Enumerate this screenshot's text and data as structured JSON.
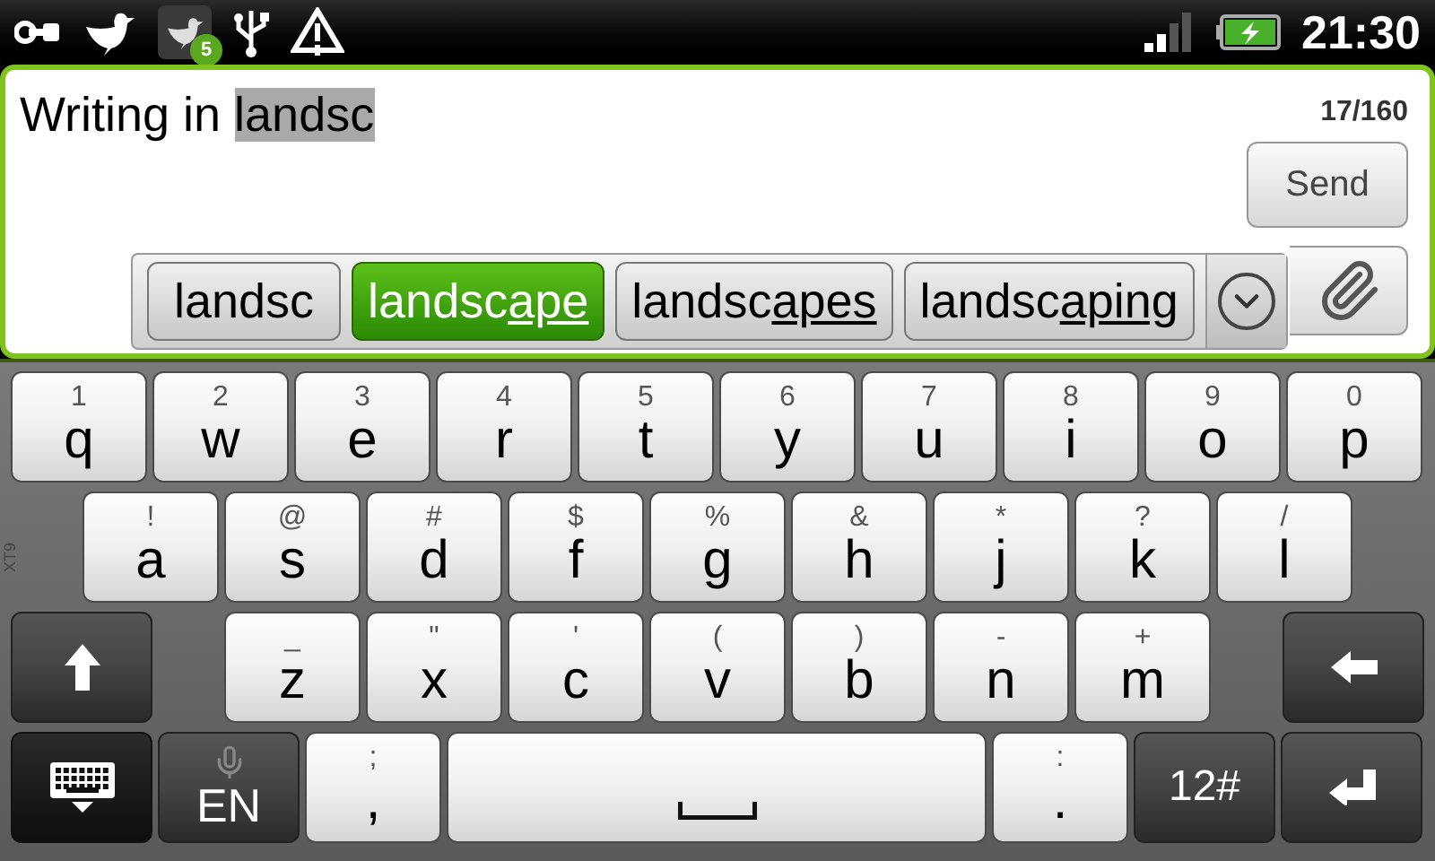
{
  "status_bar": {
    "notification_badge": "5",
    "time": "21:30"
  },
  "compose": {
    "text": "Writing in ",
    "composing": "landsc",
    "counter": "17/160",
    "send_label": "Send"
  },
  "suggestions": [
    {
      "typed": "landsc",
      "selected": false
    },
    {
      "typed": "landsc",
      "completion": "ape",
      "selected": true
    },
    {
      "typed": "landsc",
      "completion": "apes",
      "selected": false
    },
    {
      "typed": "landsc",
      "completion": "aping",
      "selected": false
    }
  ],
  "keyboard": {
    "side_label": "XT9",
    "rows": [
      [
        {
          "kind": "letter",
          "main": "q",
          "alt": "1"
        },
        {
          "kind": "letter",
          "main": "w",
          "alt": "2"
        },
        {
          "kind": "letter",
          "main": "e",
          "alt": "3"
        },
        {
          "kind": "letter",
          "main": "r",
          "alt": "4"
        },
        {
          "kind": "letter",
          "main": "t",
          "alt": "5"
        },
        {
          "kind": "letter",
          "main": "y",
          "alt": "6"
        },
        {
          "kind": "letter",
          "main": "u",
          "alt": "7"
        },
        {
          "kind": "letter",
          "main": "i",
          "alt": "8"
        },
        {
          "kind": "letter",
          "main": "o",
          "alt": "9"
        },
        {
          "kind": "letter",
          "main": "p",
          "alt": "0"
        }
      ],
      [
        {
          "kind": "letter",
          "main": "a",
          "alt": "!"
        },
        {
          "kind": "letter",
          "main": "s",
          "alt": "@"
        },
        {
          "kind": "letter",
          "main": "d",
          "alt": "#"
        },
        {
          "kind": "letter",
          "main": "f",
          "alt": "$"
        },
        {
          "kind": "letter",
          "main": "g",
          "alt": "%"
        },
        {
          "kind": "letter",
          "main": "h",
          "alt": "&"
        },
        {
          "kind": "letter",
          "main": "j",
          "alt": "*"
        },
        {
          "kind": "letter",
          "main": "k",
          "alt": "?"
        },
        {
          "kind": "letter",
          "main": "l",
          "alt": "/"
        }
      ],
      [
        {
          "kind": "shift"
        },
        {
          "kind": "letter",
          "main": "z",
          "alt": "_"
        },
        {
          "kind": "letter",
          "main": "x",
          "alt": "\""
        },
        {
          "kind": "letter",
          "main": "c",
          "alt": "'"
        },
        {
          "kind": "letter",
          "main": "v",
          "alt": "("
        },
        {
          "kind": "letter",
          "main": "b",
          "alt": ")"
        },
        {
          "kind": "letter",
          "main": "n",
          "alt": "-"
        },
        {
          "kind": "letter",
          "main": "m",
          "alt": "+"
        },
        {
          "kind": "backspace"
        }
      ],
      [
        {
          "kind": "hide"
        },
        {
          "kind": "language",
          "main": "EN"
        },
        {
          "kind": "letter",
          "main": ",",
          "alt": ";"
        },
        {
          "kind": "space"
        },
        {
          "kind": "letter",
          "main": ".",
          "alt": ":"
        },
        {
          "kind": "symbols",
          "main": "12#"
        },
        {
          "kind": "enter"
        }
      ]
    ]
  }
}
